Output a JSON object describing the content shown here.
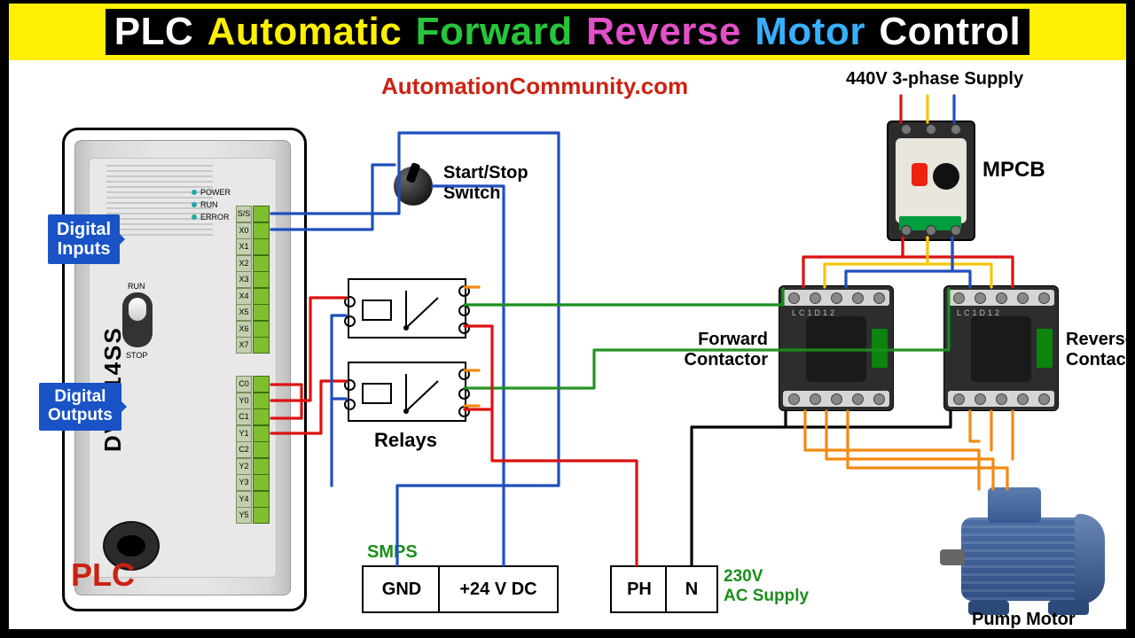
{
  "title": {
    "w1": {
      "text": "PLC",
      "color": "#ffffff"
    },
    "w2": {
      "text": "Automatic",
      "color": "#fff001"
    },
    "w3": {
      "text": "Forward",
      "color": "#26c63a"
    },
    "w4": {
      "text": "Reverse",
      "color": "#e250c8"
    },
    "w5": {
      "text": "Motor",
      "color": "#37b0ff"
    },
    "w6": {
      "text": "Control",
      "color": "#ffffff"
    }
  },
  "site": {
    "text": "AutomationCommunity.com",
    "color": "#c21"
  },
  "plc": {
    "model": "DVP-14SS",
    "label": "PLC",
    "label_color": "#c21",
    "leds": [
      "POWER",
      "RUN",
      "ERROR"
    ],
    "run_label": "RUN",
    "stop_label": "STOP",
    "digital_inputs_label": "Digital\nInputs",
    "digital_outputs_label": "Digital\nOutputs",
    "input_terms": [
      "S/S",
      "X0",
      "X1",
      "X2",
      "X3",
      "X4",
      "X5",
      "X6",
      "X7"
    ],
    "output_terms": [
      "C0",
      "Y0",
      "C1",
      "Y1",
      "C2",
      "Y2",
      "Y3",
      "Y4",
      "Y5"
    ]
  },
  "labels": {
    "start_stop": "Start/Stop\nSwitch",
    "relays": "Relays",
    "smps": "SMPS",
    "gnd": "GND",
    "v24": "+24 V DC",
    "ph": "PH",
    "n": "N",
    "ac": "230V\nAC Supply",
    "supply_440": "440V 3-phase Supply",
    "mpcb": "MPCB",
    "fwd": "Forward\nContactor",
    "rev": "Reverse\nContactor",
    "motor": "Pump Motor"
  },
  "wire_colors": {
    "phase_R": "#d11",
    "phase_Y": "#f4c60d",
    "phase_B": "#1f4fbf",
    "dc_pos": "#d11",
    "dc_neg": "#1f4fbf",
    "signal_grn": "#1a8f1a",
    "neutral": "#000",
    "orange": "#f28a12"
  }
}
